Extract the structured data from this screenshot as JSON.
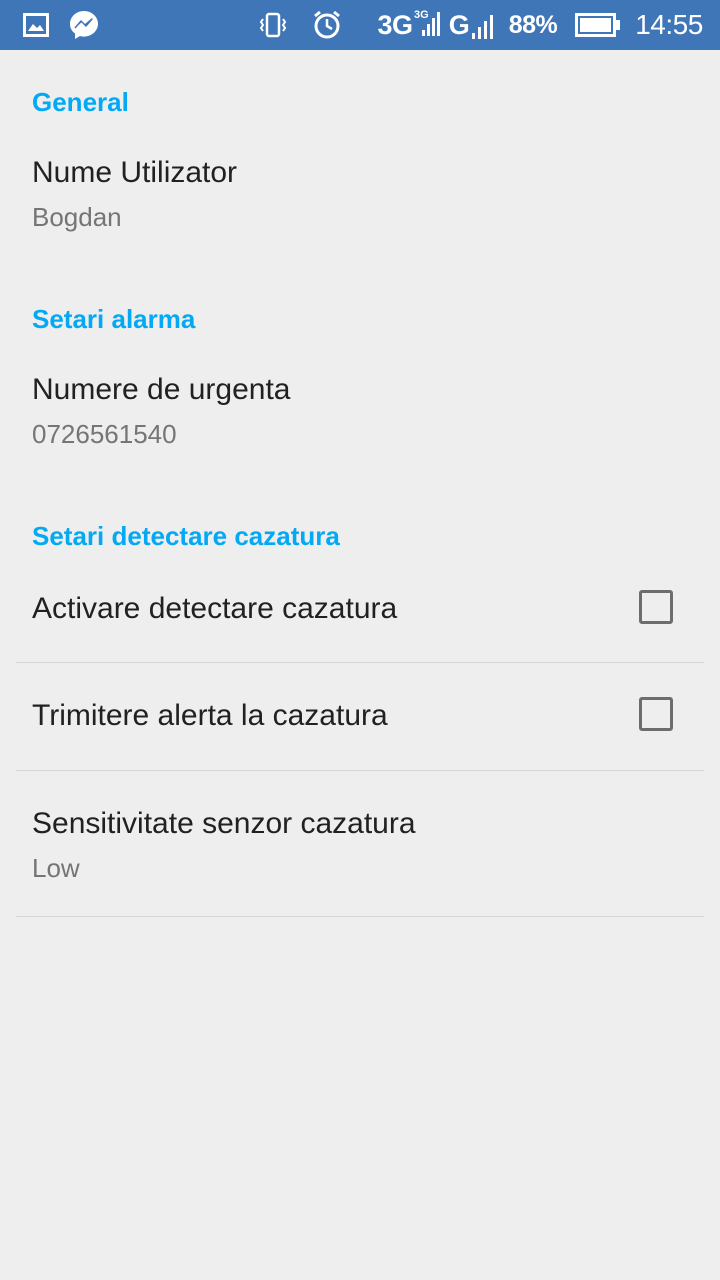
{
  "status_bar": {
    "icons": [
      "image-icon",
      "messenger-icon",
      "vibrate-icon",
      "alarm-icon"
    ],
    "network_3g": "3G",
    "network_3g_small": "3G",
    "network_g": "G",
    "battery_percent": "88%",
    "time": "14:55",
    "background_color": "#3f76b8"
  },
  "settings": {
    "general": {
      "header": "General",
      "user_name": {
        "title": "Nume Utilizator",
        "summary": "Bogdan"
      }
    },
    "alarm": {
      "header": "Setari alarma",
      "emergency_numbers": {
        "title": "Numere de urgenta",
        "summary": "0726561540"
      }
    },
    "fall_detection": {
      "header": "Setari detectare cazatura",
      "activate": {
        "title": "Activare detectare cazatura",
        "checked": false
      },
      "send_alert": {
        "title": "Trimitere alerta la cazatura",
        "checked": false
      },
      "sensitivity": {
        "title": "Sensitivitate senzor cazatura",
        "summary": "Low"
      }
    }
  },
  "colors": {
    "accent": "#03a9f4",
    "background": "#eeeeee",
    "title_text": "#212121",
    "summary_text": "#757575"
  }
}
